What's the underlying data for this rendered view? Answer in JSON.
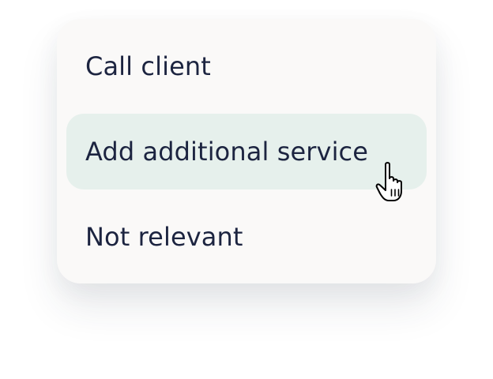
{
  "menu": {
    "items": [
      {
        "label": "Call client",
        "hovered": false
      },
      {
        "label": "Add additional service",
        "hovered": true
      },
      {
        "label": "Not relevant",
        "hovered": false
      }
    ]
  },
  "cursor": {
    "icon": "hand-pointer-icon"
  },
  "colors": {
    "panel_bg": "#faf9f8",
    "hover_bg": "#e6f0ec",
    "text": "#1c2440"
  }
}
